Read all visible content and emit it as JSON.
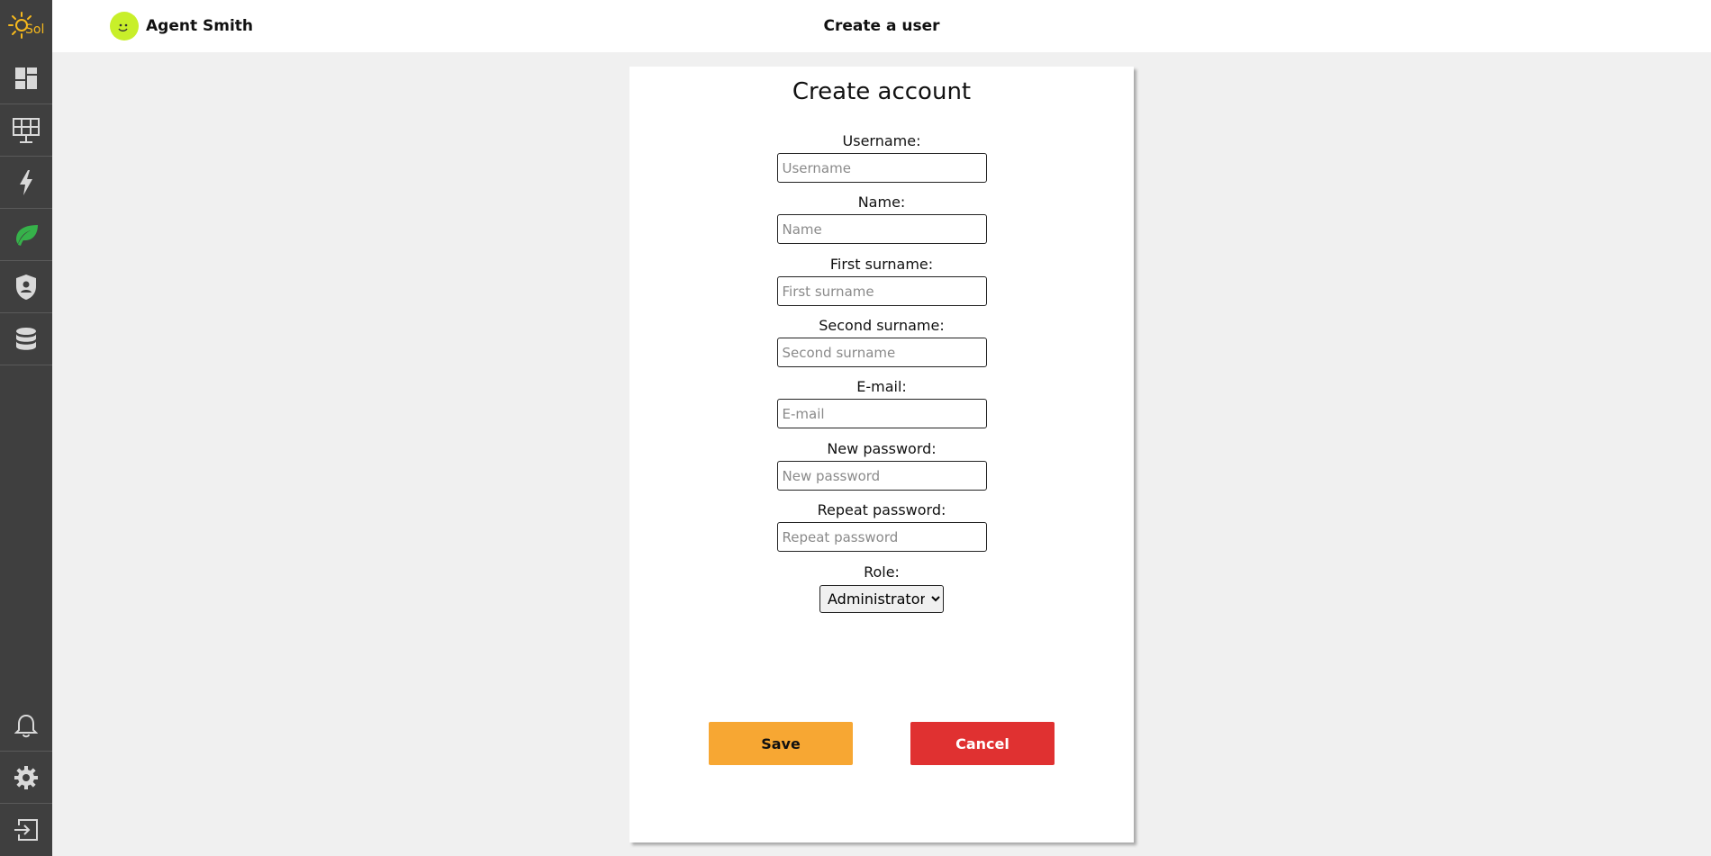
{
  "app": {
    "logo_text": "Sol"
  },
  "header": {
    "user_name": "Agent Smith",
    "page_title": "Create a user"
  },
  "sidebar": {
    "items": [
      {
        "icon": "dashboard-icon"
      },
      {
        "icon": "solar-panel-icon"
      },
      {
        "icon": "lightning-icon"
      },
      {
        "icon": "leaf-icon"
      },
      {
        "icon": "shield-icon"
      },
      {
        "icon": "database-icon"
      }
    ],
    "bottom_items": [
      {
        "icon": "bell-icon"
      },
      {
        "icon": "gear-icon"
      },
      {
        "icon": "logout-icon"
      }
    ]
  },
  "form": {
    "title": "Create account",
    "fields": [
      {
        "label": "Username:",
        "placeholder": "Username",
        "value": ""
      },
      {
        "label": "Name:",
        "placeholder": "Name",
        "value": ""
      },
      {
        "label": "First surname:",
        "placeholder": "First surname",
        "value": ""
      },
      {
        "label": "Second surname:",
        "placeholder": "Second surname",
        "value": ""
      },
      {
        "label": "E-mail:",
        "placeholder": "E-mail",
        "value": ""
      },
      {
        "label": "New password:",
        "placeholder": "New password",
        "value": ""
      },
      {
        "label": "Repeat password:",
        "placeholder": "Repeat password",
        "value": ""
      }
    ],
    "role": {
      "label": "Role:",
      "selected": "Administrator"
    },
    "save_label": "Save",
    "cancel_label": "Cancel"
  },
  "colors": {
    "sidebar": "#3f3f3f",
    "active_leaf": "#36b24a",
    "save": "#f7a733",
    "cancel": "#e03131",
    "logo": "#f5b81d",
    "avatar": "#c8ef2a"
  }
}
